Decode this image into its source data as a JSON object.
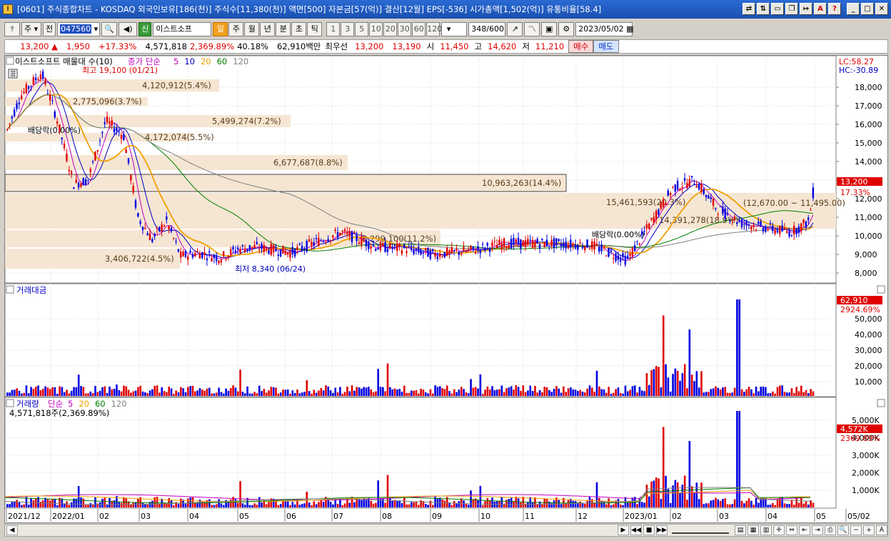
{
  "window": {
    "title": "[0601] 주식종합차트 - KOSDAQ 외국인보유[186(천)] 주식수[11,380(천)] 액면[500] 자본금[57(억)] 결산[12월] EPS[-536] 시가총액[1,502(억)] 유통비율[58.4]"
  },
  "toolbar": {
    "mode": "주",
    "prev_label": "전",
    "code": "047560",
    "listed_badge": "신",
    "stock_name": "이스트소프",
    "periods": [
      "일",
      "주",
      "월",
      "년",
      "분",
      "초",
      "틱"
    ],
    "active_period": "일",
    "intervals": [
      "1",
      "3",
      "5",
      "10",
      "20",
      "30",
      "60",
      "120"
    ],
    "count": "348",
    "count_total": "/600",
    "date": "2023/05/02"
  },
  "quote": {
    "price": "13,200",
    "change": "1,950",
    "change_pct": "+17.33%",
    "volume": "4,571,818",
    "volume_pct": "2,369.89%",
    "turnover": "40.18%",
    "amount": "62,910백만",
    "best_label": "최우선",
    "ask": "13,200",
    "bid": "13,190",
    "open_label": "시",
    "open": "11,450",
    "high_label": "고",
    "high": "14,620",
    "low_label": "저",
    "low": "11,210",
    "buy_label": "매수",
    "sell_label": "매도"
  },
  "colors": {
    "up": "#e00000",
    "down": "#0000e0",
    "ma5": "#c000c0",
    "ma10": "#0000c0",
    "ma20": "#f0a000",
    "ma60": "#008000",
    "ma120": "#808080",
    "band": "#f5e6d3"
  },
  "price_pane": {
    "legend_name": "이스트소프트 매물대 수(10)",
    "legend_ma_prefix": "종가 단순",
    "legend_mas": [
      "5",
      "10",
      "20",
      "60",
      "120"
    ],
    "lc": "LC:58.27",
    "hc": "HC:-30.89",
    "y_ticks": [
      "18,000",
      "17,000",
      "16,000",
      "15,000",
      "14,000",
      "13,000",
      "12,000",
      "11,000",
      "10,000",
      "9,000",
      "8,000"
    ],
    "current_price": "13,200",
    "current_pct": "17.33%",
    "max_note": "최고 19,100 (01/21)",
    "min_note": "최저 8,340 (06/24)",
    "dividend_1": "배당락(0.00%)",
    "dividend_2": "배당락(0.00%)",
    "band_labels": [
      "4,120,912(5.4%)",
      "2,775,096(3.7%)",
      "5,499,274(7.2%)",
      "4,172,074(5.5%)",
      "6,677,687(8.8%)",
      "10,963,263(14.4%)",
      "15,461,593(20.3%)",
      "14,391,278(18.9%)",
      "8,299,100(11.2%)",
      "3,406,722(4.5%)"
    ],
    "range_label": "(12,670.00 ~ 11,495.00)"
  },
  "amount_pane": {
    "title": "거래대금",
    "y_ticks": [
      "50,000",
      "40,000",
      "30,000",
      "20,000",
      "10,000"
    ],
    "current": "62,910",
    "current_pct": "2924.69%"
  },
  "volume_pane": {
    "title": "거래량",
    "legend_ma_prefix": "단순",
    "legend_mas": [
      "5",
      "20",
      "60",
      "120"
    ],
    "value_note": "4,571,818주(2,369.89%)",
    "y_ticks": [
      "5,000K",
      "4,000K",
      "3,000K",
      "2,000K",
      "1,000K"
    ],
    "current": "4,572K",
    "current_pct": "2369.89%"
  },
  "x_axis": [
    "2021/12",
    "2022/01",
    "02",
    "03",
    "04",
    "05",
    "06",
    "07",
    "08",
    "09",
    "10",
    "11",
    "12",
    "2023/01",
    "02",
    "03",
    "04",
    "05",
    "05/02"
  ]
}
